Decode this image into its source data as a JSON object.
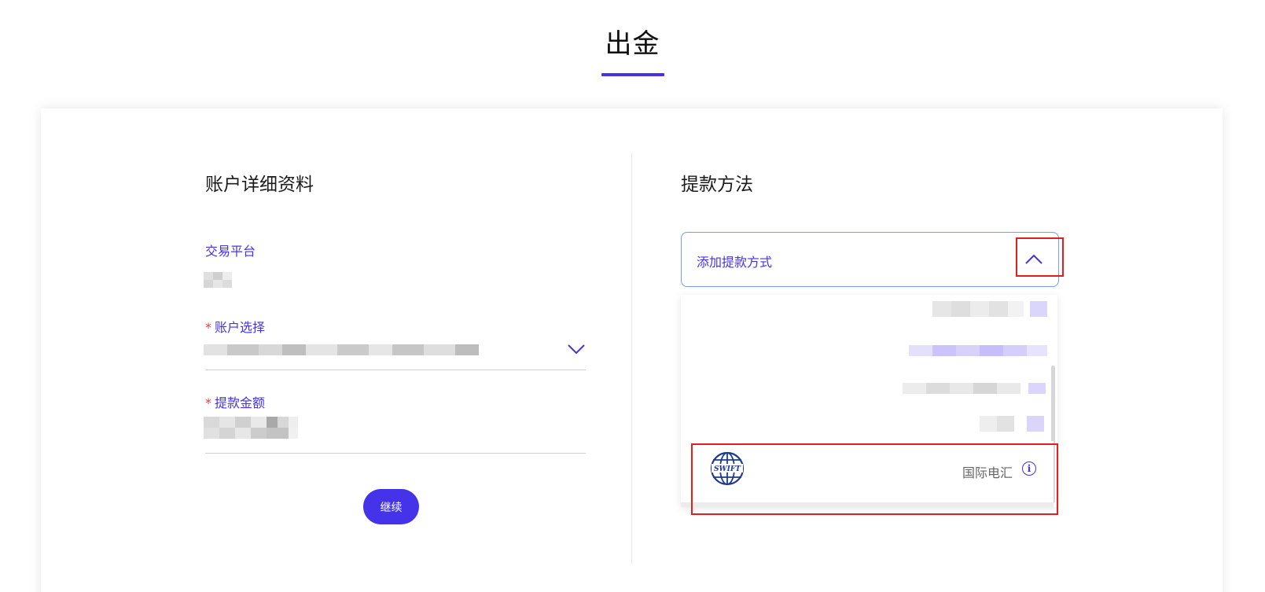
{
  "page": {
    "title": "出金"
  },
  "account_details": {
    "section_title": "账户详细资料",
    "platform_label": "交易平台",
    "account_select_label": "账户选择",
    "amount_label": "提款金额",
    "required_marker": "*",
    "continue_button": "继续"
  },
  "withdrawal_method": {
    "section_title": "提款方法",
    "select_placeholder": "添加提款方式",
    "options": [
      {
        "label": "国际电汇",
        "icon": "swift-globe-icon",
        "logo_text": "SWIFT"
      }
    ]
  },
  "colors": {
    "accent": "#4433e8",
    "highlight_red": "#e51d1d",
    "select_border": "#7a9bf2"
  }
}
